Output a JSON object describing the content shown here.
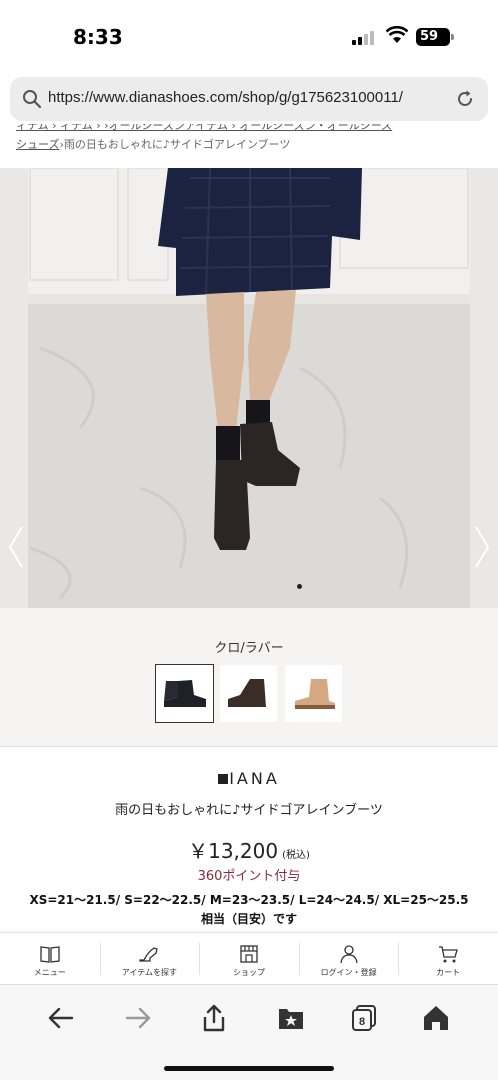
{
  "status_bar": {
    "time": "8:33",
    "battery": "59"
  },
  "url_bar": {
    "url": "https://www.dianashoes.com/shop/g/g175623100011/"
  },
  "breadcrumb": {
    "line1": "ィテム › ィテム › ›オールシーズンアイテム › オールシーズン・オールシーズ",
    "link": "シューズ",
    "current": "›雨の日もおしゃれに♪サイドゴアレインブーツ"
  },
  "gallery": {
    "prev_icon": "chevron-left-icon",
    "next_icon": "chevron-right-icon",
    "dots_total": 1,
    "dots_active": 1
  },
  "colors": {
    "selected_label": "クロ/ラバー",
    "swatches": [
      {
        "name": "black",
        "color": "#1e2128"
      },
      {
        "name": "brown",
        "color": "#3a2c27"
      },
      {
        "name": "beige",
        "color": "#d4a883"
      }
    ]
  },
  "product": {
    "brand": "IANA",
    "name": "雨の日もおしゃれに♪サイドゴアレインブーツ",
    "price": "￥13,200",
    "tax": "(税込)",
    "points": "360ポイント付与",
    "sizes": "XS=21～21.5/ S=22～22.5/ M=23～23.5/ L=24～24.5/ XL=25～25.5",
    "sizes_note": "相当（目安）です"
  },
  "site_nav": {
    "items": [
      {
        "label": "メニュー",
        "icon": "book-icon"
      },
      {
        "label": "アイテムを探す",
        "icon": "shoe-icon"
      },
      {
        "label": "ショップ",
        "icon": "shop-icon"
      },
      {
        "label": "ログイン・登録",
        "icon": "user-icon"
      },
      {
        "label": "カート",
        "icon": "cart-icon"
      }
    ]
  },
  "browser_toolbar": {
    "tabs_count": "8"
  }
}
